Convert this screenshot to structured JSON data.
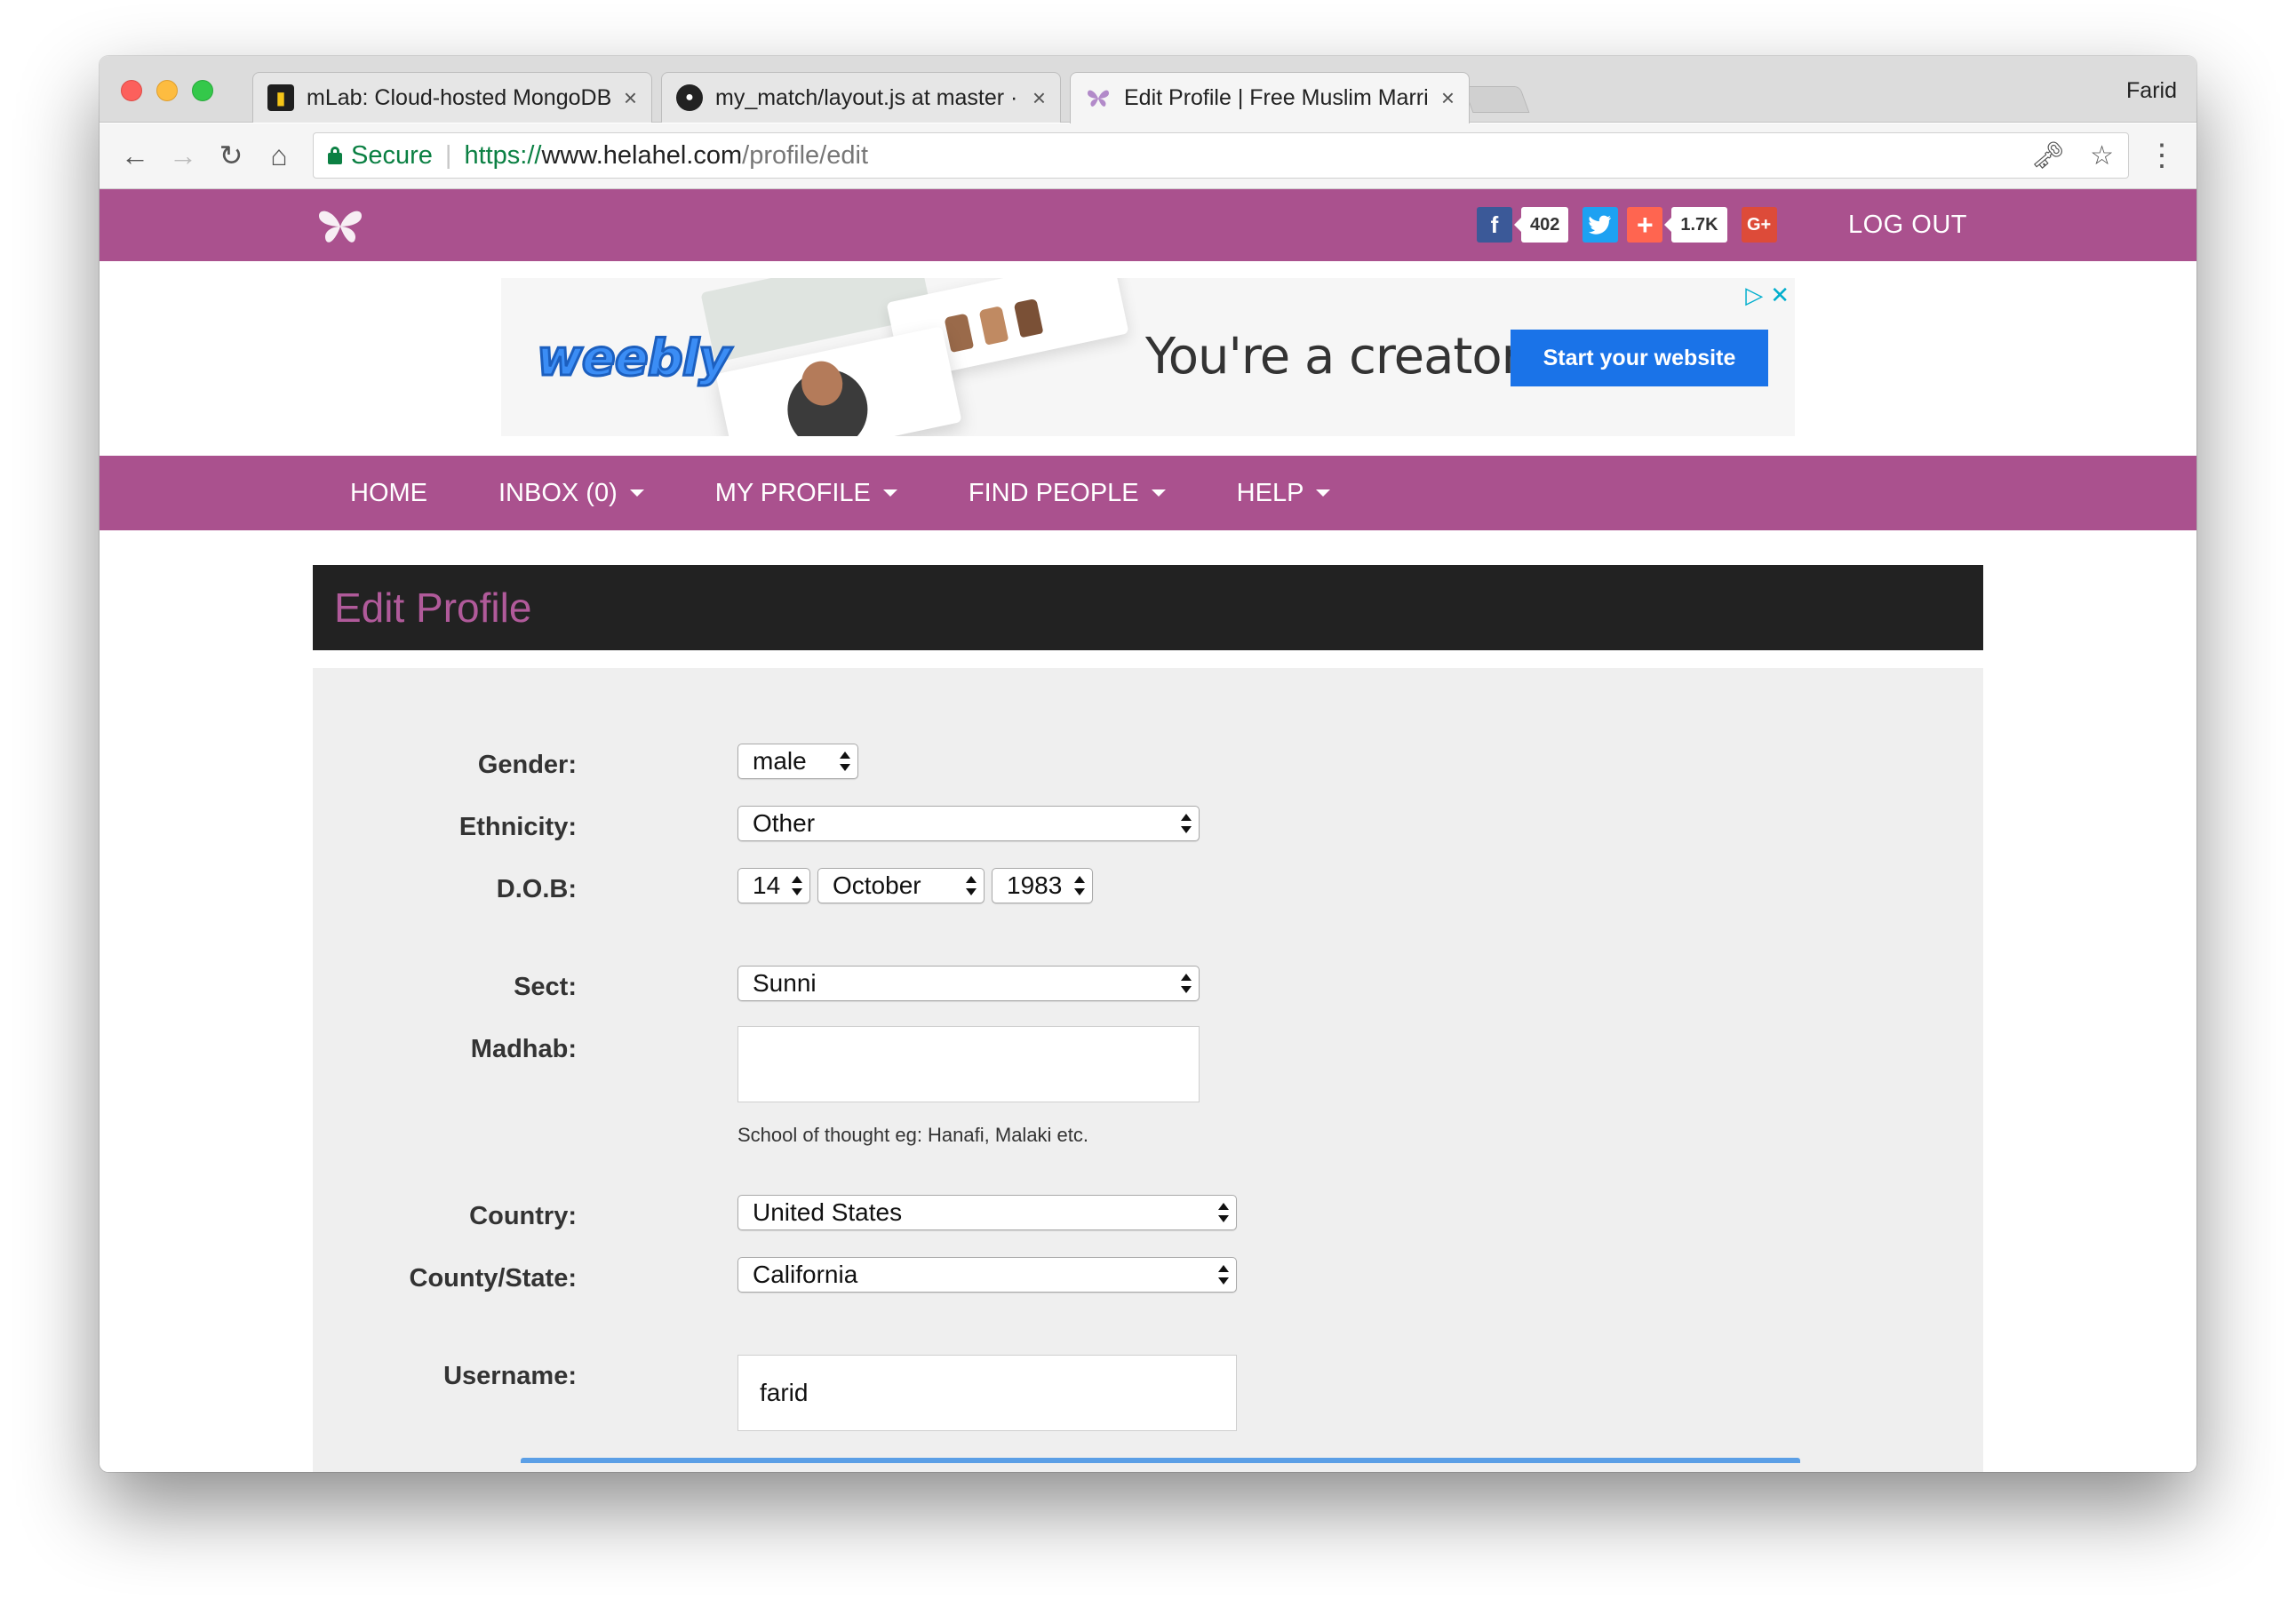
{
  "browser": {
    "tabs": [
      {
        "title": "mLab: Cloud-hosted MongoDB",
        "icon": "mlab-icon"
      },
      {
        "title": "my_match/layout.js at master ·",
        "icon": "github-icon"
      },
      {
        "title": "Edit Profile | Free Muslim Marri",
        "icon": "butterfly-icon",
        "active": true
      }
    ],
    "profile_name": "Farid",
    "address": {
      "secure_label": "Secure",
      "scheme": "https://",
      "host": "www.helahel.com",
      "path": "/profile/edit"
    }
  },
  "site": {
    "brand_color": "#aa518e",
    "share": {
      "facebook_count": "402",
      "addthis_count": "1.7K"
    },
    "logout_label": "LOG OUT"
  },
  "ad": {
    "brand": "weebly",
    "headline": "You're a creator",
    "cta": "Start your website"
  },
  "nav": {
    "items": [
      {
        "label": "HOME",
        "dropdown": false
      },
      {
        "label": "INBOX (0)",
        "dropdown": true
      },
      {
        "label": "MY PROFILE",
        "dropdown": true
      },
      {
        "label": "FIND PEOPLE",
        "dropdown": true
      },
      {
        "label": "HELP",
        "dropdown": true
      }
    ]
  },
  "page": {
    "title": "Edit Profile"
  },
  "form": {
    "gender": {
      "label": "Gender:",
      "value": "male"
    },
    "ethnicity": {
      "label": "Ethnicity:",
      "value": "Other"
    },
    "dob": {
      "label": "D.O.B:",
      "day": "14",
      "month": "October",
      "year": "1983"
    },
    "sect": {
      "label": "Sect:",
      "value": "Sunni"
    },
    "madhab": {
      "label": "Madhab:",
      "value": "",
      "hint": "School of thought eg: Hanafi, Malaki etc."
    },
    "country": {
      "label": "Country:",
      "value": "United States"
    },
    "state": {
      "label": "County/State:",
      "value": "California"
    },
    "username": {
      "label": "Username:",
      "value": "farid"
    }
  }
}
